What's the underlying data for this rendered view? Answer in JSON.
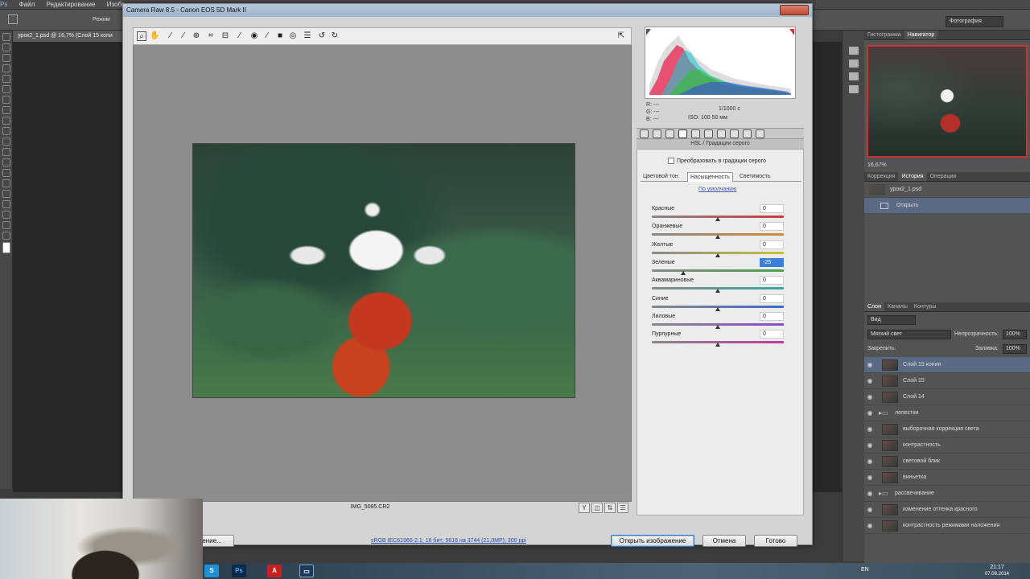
{
  "ps": {
    "menu": [
      "Файл",
      "Редактирование",
      "Изобр"
    ],
    "mode_label": "Режим",
    "doc_tab": "урок2_1.psd @ 16,7% (Слой 15 копи",
    "workspace": "Фотография"
  },
  "dialog": {
    "title": "Camera Raw 8.5  -  Canon EOS 5D Mark II",
    "filename": "IMG_5085.CR2",
    "workflow_link": "sRGB IEC61966-2.1; 16 бит; 5616 на 3744 (21,0МР); 300 ppi",
    "buttons": {
      "save": "жение...",
      "open": "Открыть изображение",
      "cancel": "Отмена",
      "done": "Готово"
    }
  },
  "readout": {
    "r": "R:  ---",
    "g": "G:  ---",
    "b": "B:  ---",
    "shutter": "1/1000 с",
    "iso_focal": "ISO: 100    50 мм"
  },
  "hsl": {
    "panel_title": "HSL / Градации серого",
    "grayscale_label": "Преобразовать в градации серого",
    "tabs": [
      "Цветовой тон",
      "Насыщенность",
      "Светимость"
    ],
    "active_tab": "Насыщенность",
    "default_link": "По умолчанию",
    "sliders": [
      {
        "label": "Красные",
        "value": "0",
        "position": 0.5,
        "color": "#cc3b3b"
      },
      {
        "label": "Оранжевые",
        "value": "0",
        "position": 0.5,
        "color": "#d08a3a"
      },
      {
        "label": "Желтые",
        "value": "0",
        "position": 0.5,
        "color": "#c9c23a"
      },
      {
        "label": "Зеленые",
        "value": "-25",
        "position": 0.24,
        "color": "#4aa04a",
        "selected": true
      },
      {
        "label": "Аквамариновые",
        "value": "0",
        "position": 0.5,
        "color": "#3aa8a0"
      },
      {
        "label": "Синие",
        "value": "0",
        "position": 0.5,
        "color": "#3a6ac9"
      },
      {
        "label": "Лиловые",
        "value": "0",
        "position": 0.5,
        "color": "#8a4ac9"
      },
      {
        "label": "Пурпурные",
        "value": "0",
        "position": 0.5,
        "color": "#c03aa0"
      }
    ]
  },
  "right": {
    "nav_tabs": [
      "Гистограмма",
      "Навигатор"
    ],
    "zoom": "16,67%",
    "hist_tabs": [
      "Коррекция",
      "История",
      "Операции"
    ],
    "history": [
      {
        "label": "урок2_1.psd",
        "thumb": true
      },
      {
        "label": "Открыть",
        "selected": true
      }
    ],
    "layer_tabs": [
      "Слои",
      "Каналы",
      "Контуры"
    ],
    "kind": "Вид",
    "blend": "Мягкий свет",
    "opacity_label": "Непрозрачность:",
    "opacity": "100%",
    "lock_label": "Закрепить:",
    "fill_label": "Заливка:",
    "fill": "100%",
    "layers": [
      {
        "name": "Слой 15 копия",
        "selected": true
      },
      {
        "name": "Слой 15"
      },
      {
        "name": "Слой 14"
      },
      {
        "name": "лепестки",
        "folder": true
      },
      {
        "name": "выборочная коррекция света"
      },
      {
        "name": "контрастность"
      },
      {
        "name": "световой блик"
      },
      {
        "name": "виньетка"
      },
      {
        "name": "рассвечивание",
        "folder": true
      },
      {
        "name": "изменение оттенка красного"
      },
      {
        "name": "контрастность режимами наложения"
      }
    ]
  },
  "taskbar": {
    "apps": [
      "S",
      "Ps",
      "A",
      "▭"
    ],
    "lang": "EN",
    "time": "21:17",
    "date": "07.08.2014"
  }
}
